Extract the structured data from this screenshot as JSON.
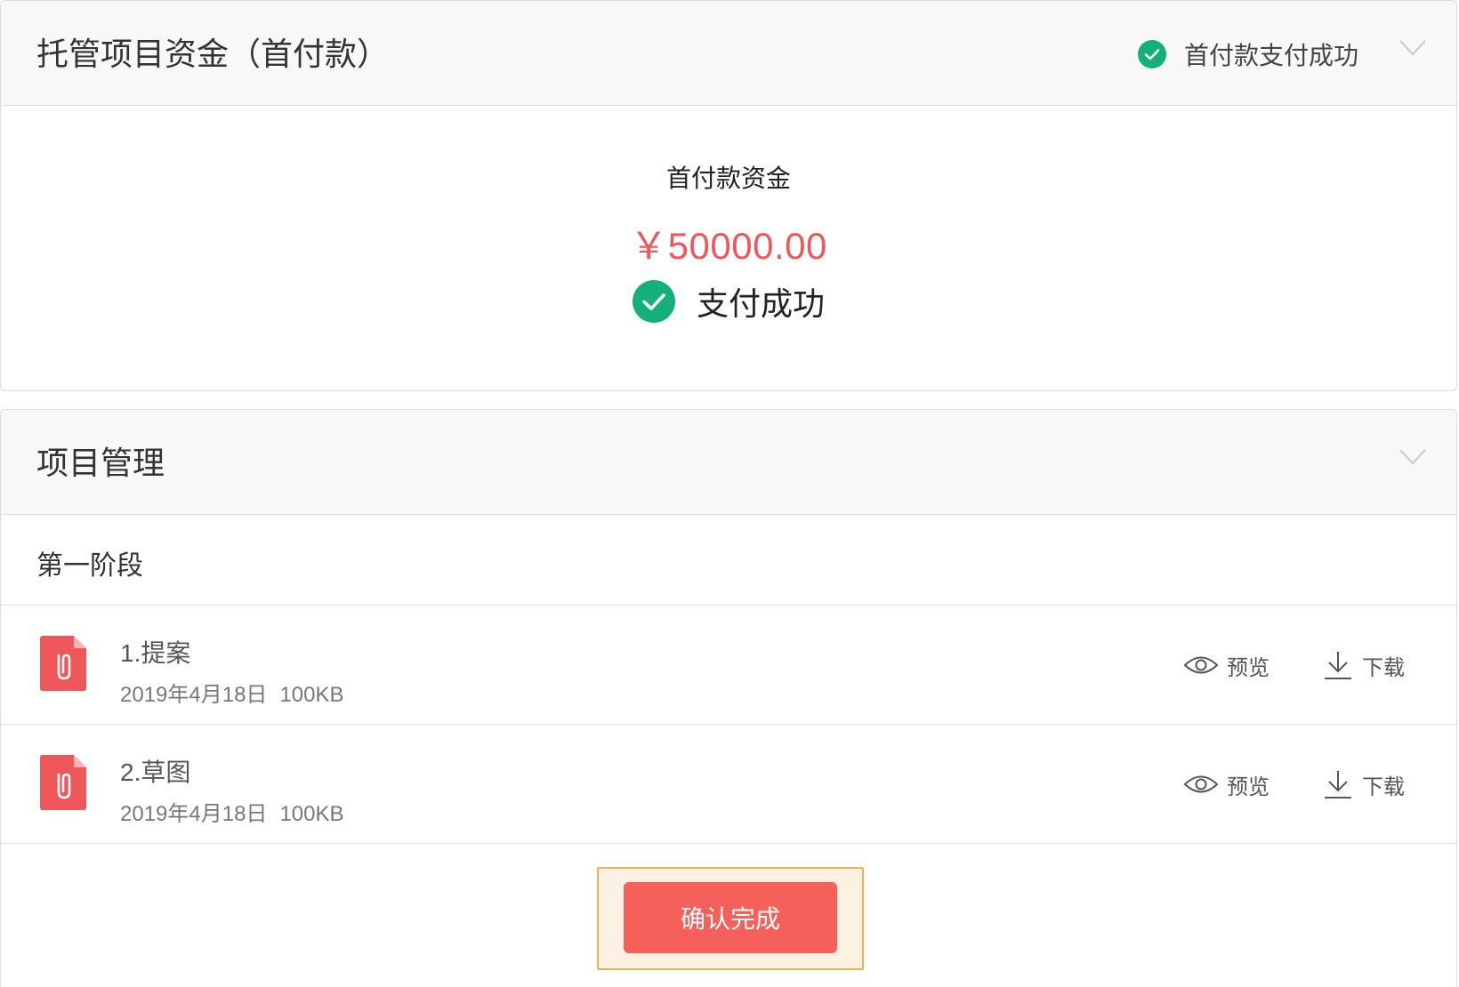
{
  "escrow": {
    "title": "托管项目资金（首付款）",
    "header_status": "首付款支付成功",
    "fund_label": "首付款资金",
    "amount": "￥50000.00",
    "pay_status": "支付成功"
  },
  "project": {
    "title": "项目管理",
    "stage_title": "第一阶段",
    "files": [
      {
        "name": "1.提案",
        "date": "2019年4月18日",
        "size": "100KB"
      },
      {
        "name": "2.草图",
        "date": "2019年4月18日",
        "size": "100KB"
      }
    ],
    "preview_label": "预览",
    "download_label": "下载",
    "confirm_label": "确认完成"
  },
  "colors": {
    "success": "#13b07c",
    "amount": "#f0575b",
    "file_icon": "#f0575b",
    "confirm_button": "#f6605a",
    "highlight_border": "#f5b04a"
  },
  "icons": [
    "check-circle-icon",
    "chevron-down-icon",
    "file-attachment-icon",
    "eye-icon",
    "download-icon"
  ]
}
